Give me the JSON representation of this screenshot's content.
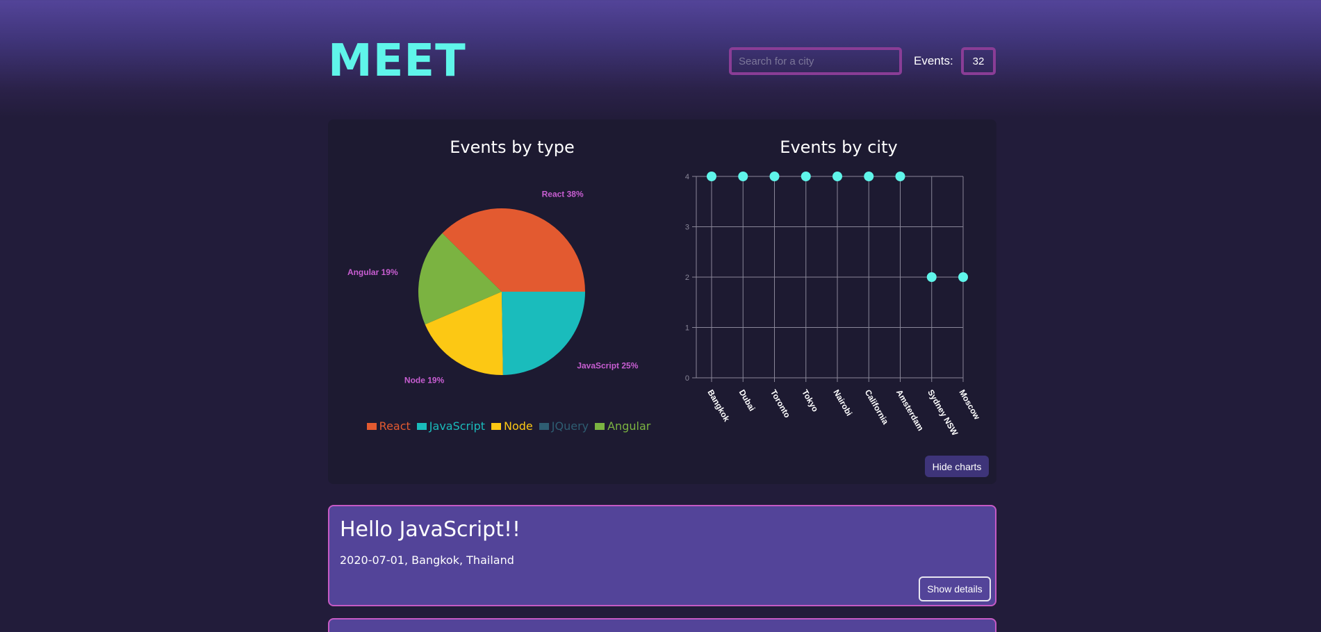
{
  "header": {
    "logo": "MEET",
    "search_placeholder": "Search for a city",
    "events_label": "Events:",
    "events_count": "32"
  },
  "charts": {
    "hide_button": "Hide charts"
  },
  "chart_data": [
    {
      "type": "pie",
      "title": "Events by type",
      "slices": [
        {
          "name": "React",
          "value": 38,
          "label": "React 38%",
          "color": "#e35a30"
        },
        {
          "name": "Angular",
          "value": 19,
          "label": "Angular 19%",
          "color": "#7bb341"
        },
        {
          "name": "Node",
          "value": 19,
          "label": "Node 19%",
          "color": "#fcc814"
        },
        {
          "name": "JavaScript",
          "value": 25,
          "label": "JavaScript 25%",
          "color": "#1abcbc"
        }
      ],
      "legend": [
        {
          "name": "React",
          "color": "#e35a30"
        },
        {
          "name": "JavaScript",
          "color": "#1abcbc"
        },
        {
          "name": "Node",
          "color": "#fcc814"
        },
        {
          "name": "JQuery",
          "color": "#2e5d72"
        },
        {
          "name": "Angular",
          "color": "#7bb341"
        }
      ],
      "label_color": "#c85ed2",
      "legend_placement": "bottom"
    },
    {
      "type": "scatter",
      "title": "Events by city",
      "categories": [
        "Bangkok",
        "Dubai",
        "Toronto",
        "Tokyo",
        "Nairobi",
        "California",
        "Amsterdam",
        "Sydney NSW",
        "Moscow"
      ],
      "values": [
        4,
        4,
        4,
        4,
        4,
        4,
        4,
        2,
        2
      ],
      "yticks": [
        "0",
        "1",
        "2",
        "3",
        "4"
      ],
      "ylim": [
        0,
        4
      ],
      "grid": true,
      "point_color": "#5ff5ea"
    }
  ],
  "events": [
    {
      "title": "Hello JavaScript!!",
      "meta": "2020-07-01, Bangkok, Thailand",
      "button": "Show details"
    }
  ]
}
